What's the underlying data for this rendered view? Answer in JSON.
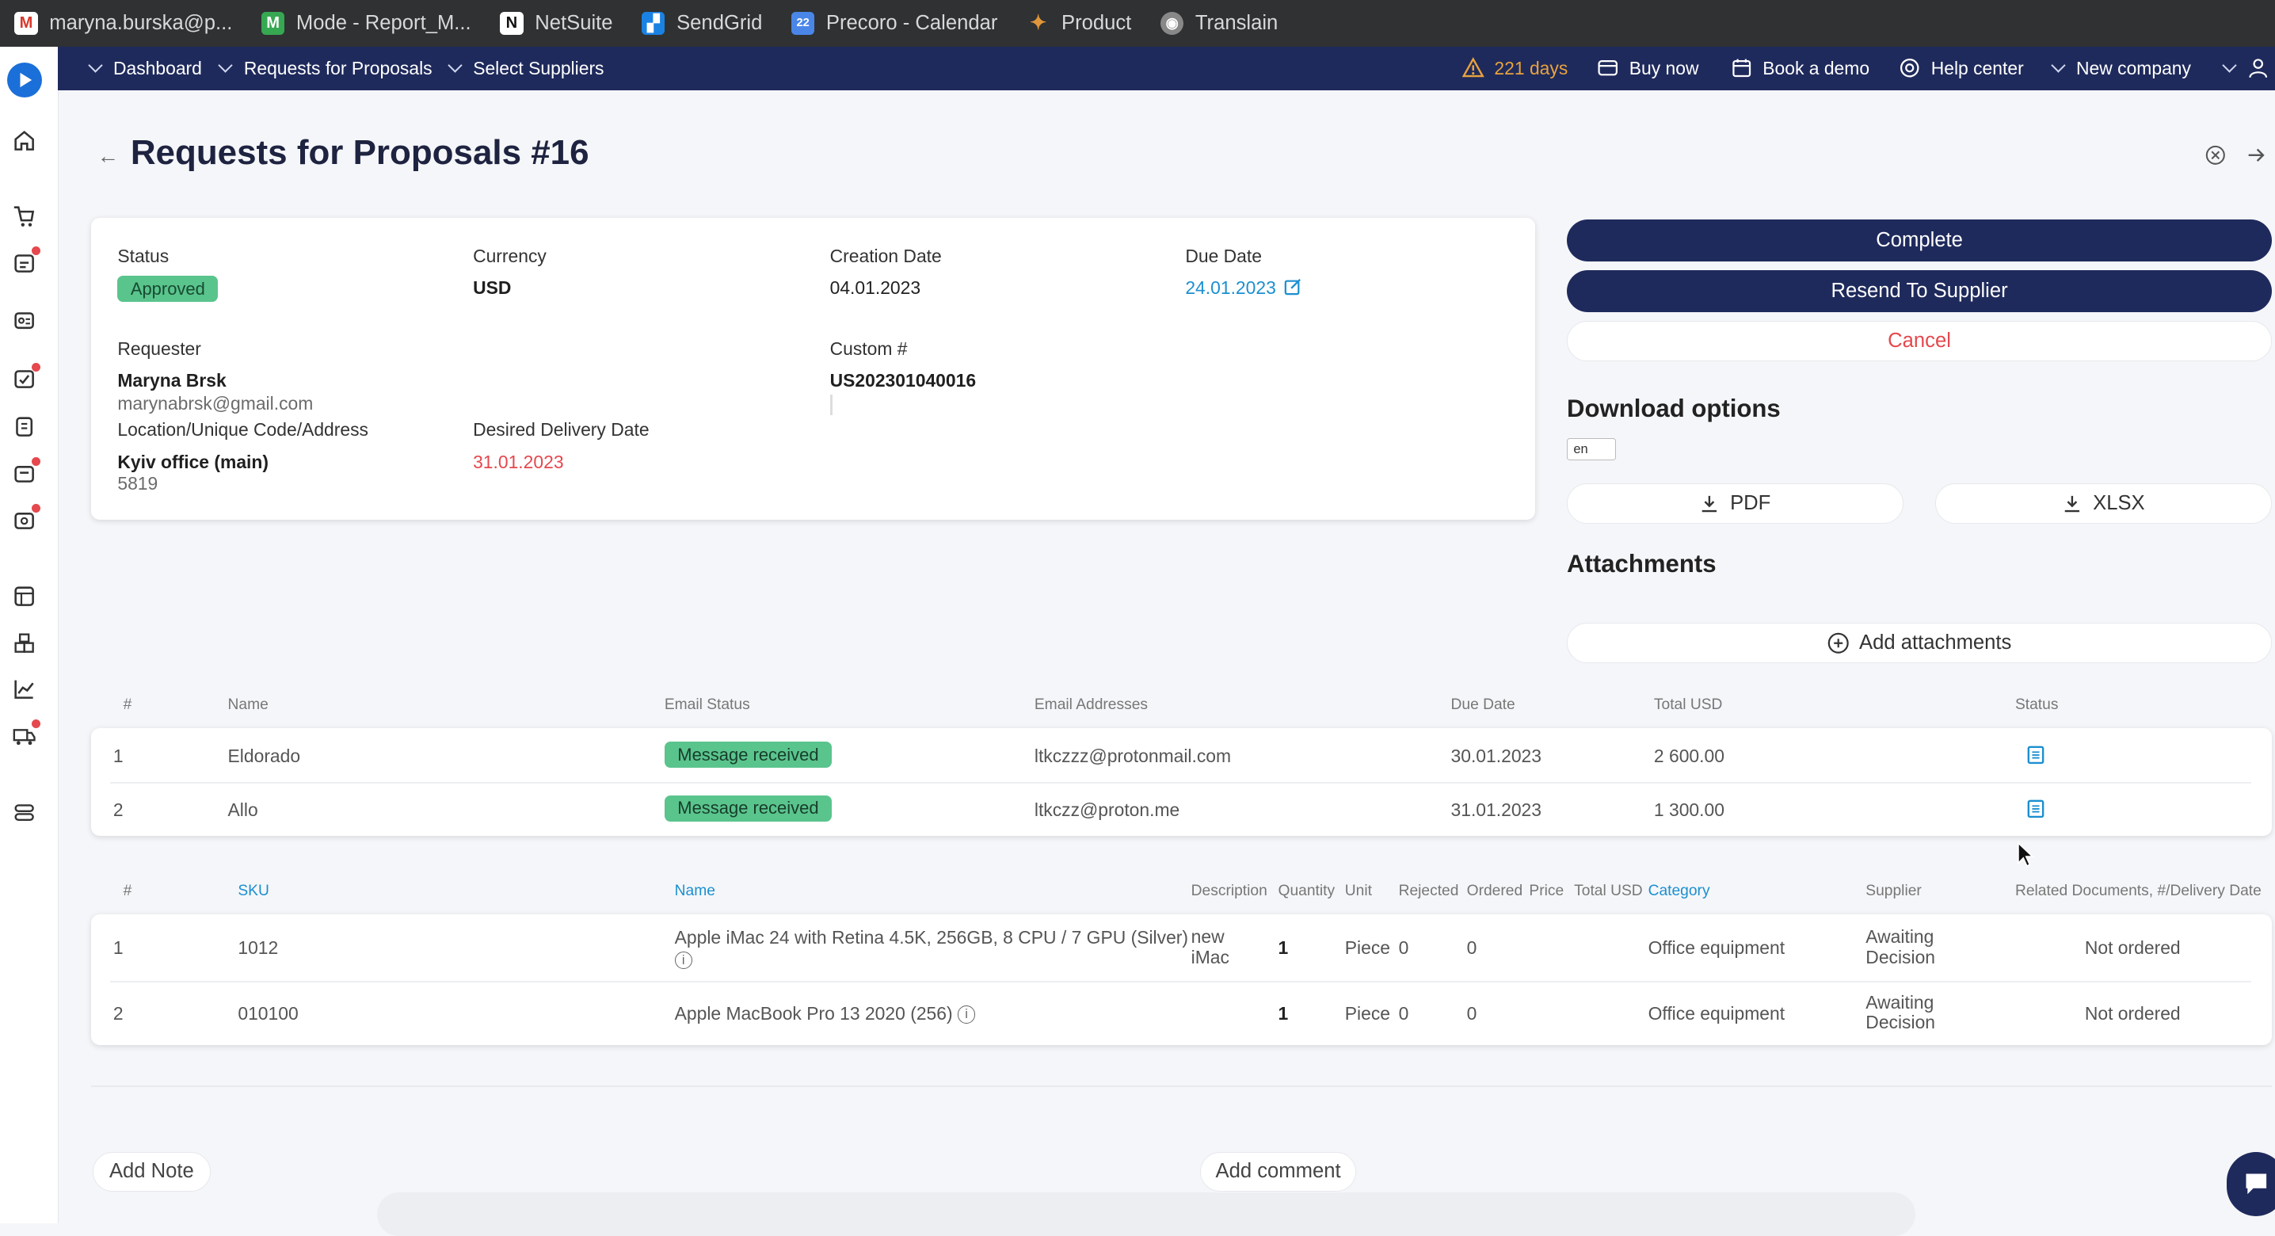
{
  "bookmarks": [
    {
      "label": "maryna.burska@p...",
      "icon": "gmail-icon",
      "color": "#d9382b",
      "glyph": "M"
    },
    {
      "label": "Mode - Report_M...",
      "icon": "mode-icon",
      "color": "#36a852",
      "glyph": "M"
    },
    {
      "label": "NetSuite",
      "icon": "netsuite-icon",
      "color": "#111111",
      "glyph": "N"
    },
    {
      "label": "SendGrid",
      "icon": "sendgrid-icon",
      "color": "#1a82e2",
      "glyph": "▞"
    },
    {
      "label": "Precoro - Calendar",
      "icon": "calendar-icon",
      "color": "#4a86e8",
      "glyph": "22"
    },
    {
      "label": "Product",
      "icon": "product-icon",
      "color": "#c7761e",
      "glyph": "✦"
    },
    {
      "label": "Translain",
      "icon": "globe-icon",
      "color": "#777777",
      "glyph": "◉"
    }
  ],
  "nav": {
    "dashboard": "Dashboard",
    "rfp": "Requests for Proposals",
    "select_suppliers": "Select Suppliers",
    "trial_days": "221 days",
    "buy_now": "Buy now",
    "book_demo": "Book a demo",
    "help_center": "Help center",
    "new_company": "New company"
  },
  "page": {
    "title": "Requests for Proposals #16"
  },
  "info": {
    "status_label": "Status",
    "status_value": "Approved",
    "currency_label": "Currency",
    "currency_value": "USD",
    "creation_label": "Creation Date",
    "creation_value": "04.01.2023",
    "due_label": "Due Date",
    "due_value": "24.01.2023",
    "requester_label": "Requester",
    "requester_name": "Maryna Brsk",
    "requester_email": "marynabrsk@gmail.com",
    "custom_label": "Custom #",
    "custom_value": "US202301040016",
    "location_label": "Location/Unique Code/Address",
    "location_value": "Kyiv office (main)",
    "location_code": "5819",
    "delivery_label": "Desired Delivery Date",
    "delivery_value": "31.01.2023"
  },
  "actions": {
    "complete": "Complete",
    "resend": "Resend To Supplier",
    "cancel": "Cancel"
  },
  "download": {
    "title": "Download options",
    "lang": "en",
    "pdf": "PDF",
    "xlsx": "XLSX"
  },
  "attachments": {
    "title": "Attachments",
    "add": "Add attachments"
  },
  "suppliers": {
    "headers": [
      "#",
      "Name",
      "Email Status",
      "Email Addresses",
      "Due Date",
      "Total USD",
      "Status"
    ],
    "rows": [
      {
        "num": "1",
        "name": "Eldorado",
        "email_status": "Message received",
        "email": "ltkczzz@protonmail.com",
        "due": "30.01.2023",
        "total": "2 600.00"
      },
      {
        "num": "2",
        "name": "Allo",
        "email_status": "Message received",
        "email": "ltkczz@proton.me",
        "due": "31.01.2023",
        "total": "1 300.00"
      }
    ]
  },
  "items": {
    "headers": [
      "#",
      "SKU",
      "Name",
      "Description",
      "Quantity",
      "Unit",
      "Rejected",
      "Ordered",
      "Price",
      "Total USD",
      "Category",
      "Supplier",
      "Related Documents, #/Delivery Date"
    ],
    "rows": [
      {
        "num": "1",
        "sku": "1012",
        "name": "Apple iMac 24 with Retina 4.5K, 256GB, 8 CPU / 7 GPU (Silver)",
        "desc1": "new",
        "desc2": "iMac",
        "qty": "1",
        "unit": "Piece",
        "rejected": "0",
        "ordered": "0",
        "category": "Office equipment",
        "supplier1": "Awaiting",
        "supplier2": "Decision",
        "related": "Not ordered"
      },
      {
        "num": "2",
        "sku": "010100",
        "name": "Apple MacBook Pro 13 2020 (256)",
        "desc1": "",
        "desc2": "",
        "qty": "1",
        "unit": "Piece",
        "rejected": "0",
        "ordered": "0",
        "category": "Office equipment",
        "supplier1": "Awaiting",
        "supplier2": "Decision",
        "related": "Not ordered"
      }
    ]
  },
  "footer": {
    "add_note": "Add Note",
    "add_comment": "Add comment"
  },
  "colors": {
    "nav_bg": "#1f2a5c",
    "accent_blue": "#1b8fd0",
    "badge_green": "#5ac48d",
    "warning": "#e8a33d",
    "danger": "#e5484d"
  }
}
